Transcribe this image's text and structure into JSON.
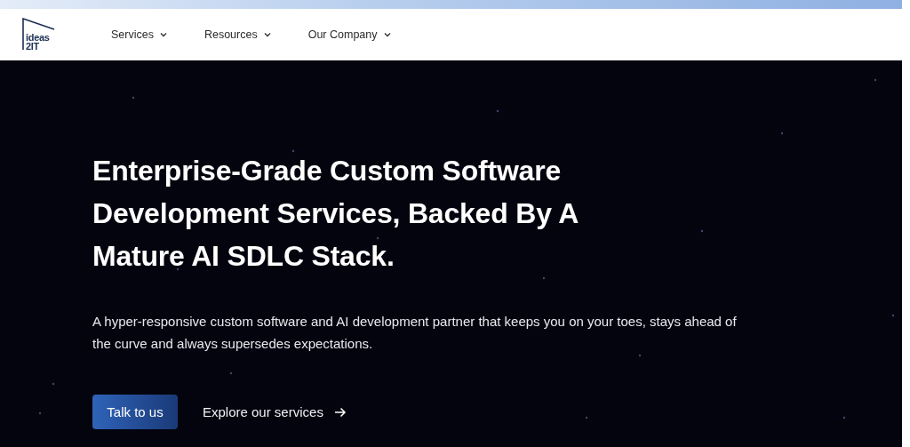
{
  "logo": {
    "line_1": "ideas",
    "line_2": "2IT"
  },
  "nav": [
    {
      "label": "Services",
      "expanded": false
    },
    {
      "label": "Resources",
      "expanded": false
    },
    {
      "label": "Our Company",
      "expanded": false
    }
  ],
  "hero": {
    "title": "Enterprise-Grade Custom Software Development Services, Backed By A Mature AI SDLC Stack.",
    "subtitle": "A hyper-responsive custom software and AI development partner that keeps you on your toes, stays ahead of the curve and always supersedes expectations.",
    "primary_button": "Talk to us",
    "secondary_link": "Explore our services"
  }
}
